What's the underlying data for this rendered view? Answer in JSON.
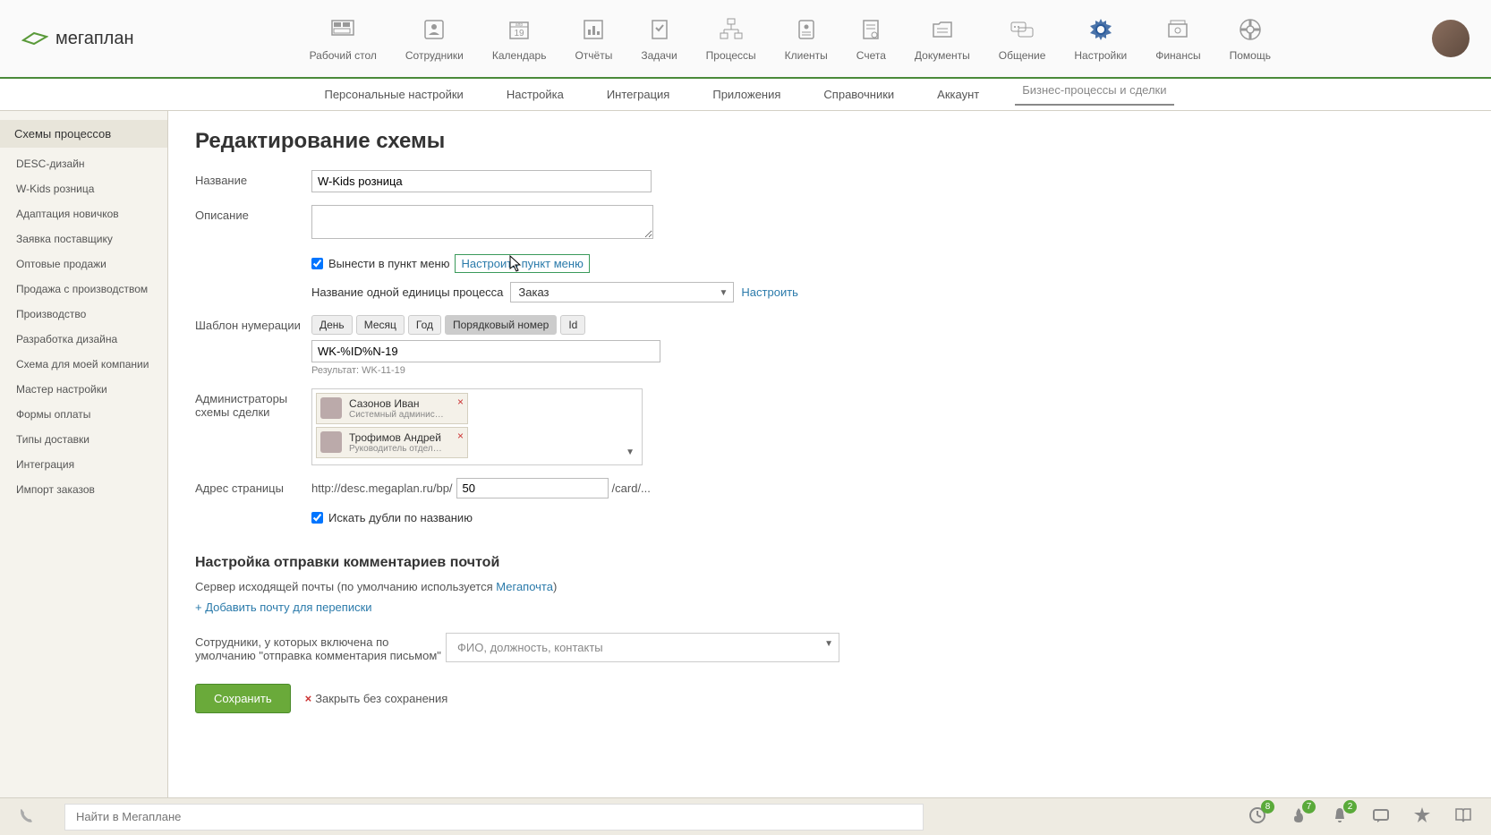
{
  "logo_text": "мегаплан",
  "nav": [
    {
      "label": "Рабочий стол"
    },
    {
      "label": "Сотрудники"
    },
    {
      "label": "Календарь"
    },
    {
      "label": "Отчёты"
    },
    {
      "label": "Задачи"
    },
    {
      "label": "Процессы"
    },
    {
      "label": "Клиенты"
    },
    {
      "label": "Счета"
    },
    {
      "label": "Документы"
    },
    {
      "label": "Общение"
    },
    {
      "label": "Настройки"
    },
    {
      "label": "Финансы"
    },
    {
      "label": "Помощь"
    }
  ],
  "subnav": [
    "Персональные настройки",
    "Настройка",
    "Интеграция",
    "Приложения",
    "Справочники",
    "Аккаунт",
    "Бизнес-процессы и сделки"
  ],
  "sidebar": {
    "group1_title": "Схемы процессов",
    "group1_items": [
      "DESC-дизайн",
      "W-Kids розница",
      "Адаптация новичков",
      "Заявка поставщику",
      "Оптовые продажи",
      "Продажа с производством",
      "Производство",
      "Разработка дизайна",
      "Схема для моей компании"
    ],
    "items2": [
      "Мастер настройки",
      "Формы оплаты",
      "Типы доставки",
      "Интеграция",
      "Импорт заказов"
    ]
  },
  "page_title": "Редактирование схемы",
  "form": {
    "name_label": "Название",
    "name_value": "W-Kids розница",
    "desc_label": "Описание",
    "desc_value": "",
    "menu_checkbox_label": "Вынести в пункт меню",
    "menu_link": "Настроить пункт меню",
    "unit_label": "Название одной единицы процесса",
    "unit_value": "Заказ",
    "unit_link": "Настроить",
    "numbering_label": "Шаблон нумерации",
    "chips": [
      "День",
      "Месяц",
      "Год",
      "Порядковый номер",
      "Id"
    ],
    "numbering_value": "WK-%ID%N-19",
    "numbering_result": "Результат: WK-11-19",
    "admins_label": "Администраторы схемы сделки",
    "admins": [
      {
        "name": "Сазонов Иван",
        "role": "Системный администратор"
      },
      {
        "name": "Трофимов Андрей",
        "role": "Руководитель отдела пр..."
      }
    ],
    "url_label": "Адрес страницы",
    "url_prefix": "http://desc.megaplan.ru/bp/",
    "url_value": "50",
    "url_suffix": "/card/...",
    "dupes_label": "Искать дубли по названию"
  },
  "mail": {
    "section_title": "Настройка отправки комментариев почтой",
    "server_text": "Сервер исходящей почты (по умолчанию используется ",
    "server_link": "Мегапочта",
    "server_close": ")",
    "add_link": "+ Добавить почту для переписки",
    "employees_label": "Сотрудники, у которых включена по умолчанию \"отправка комментария письмом\"",
    "employees_placeholder": "ФИО, должность, контакты"
  },
  "actions": {
    "save": "Сохранить",
    "cancel": "Закрыть без сохранения"
  },
  "bottombar": {
    "search_placeholder": "Найти в Мегаплане",
    "badges": {
      "clock": "8",
      "fire": "7",
      "bell": "2"
    }
  }
}
